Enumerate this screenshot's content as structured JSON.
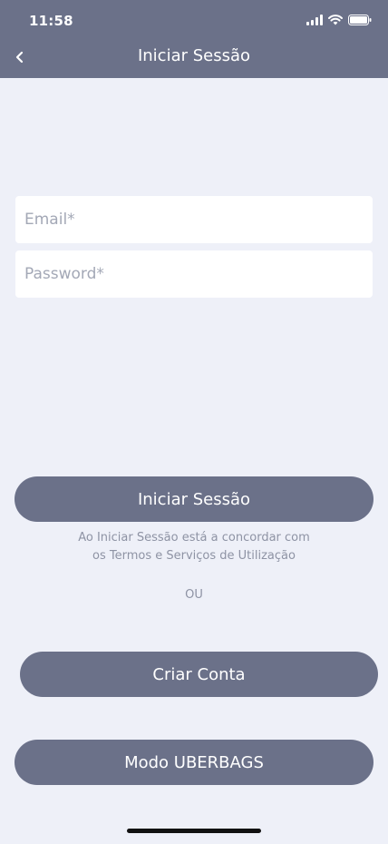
{
  "status_bar": {
    "time": "11:58"
  },
  "nav": {
    "title": "Iniciar Sessão",
    "back_icon": "chevron-left-icon"
  },
  "form": {
    "email_placeholder": "Email*",
    "password_placeholder": "Password*"
  },
  "actions": {
    "login_label": "Iniciar Sessão",
    "terms_line1": "Ao Iniciar Sessão está a concordar com",
    "terms_line2": "os Termos e Serviços de Utilização",
    "or_label": "OU",
    "create_account_label": "Criar Conta",
    "uberbags_label": "Modo UBERBAGS"
  },
  "colors": {
    "header": "#6b7189",
    "background": "#eef0f8",
    "button": "#6b7189",
    "muted_text": "#8e93a4"
  }
}
